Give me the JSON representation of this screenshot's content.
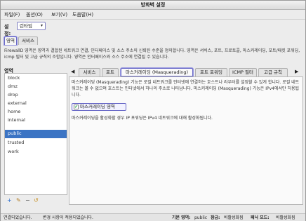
{
  "window": {
    "title": "방화벽 설정"
  },
  "menu": {
    "items": [
      {
        "label": "파일(F)"
      },
      {
        "label": "옵션(O)"
      },
      {
        "label": "보기(V)"
      },
      {
        "label": "도움말(H)"
      }
    ]
  },
  "config": {
    "label": "설정:",
    "value": "런타임"
  },
  "main_tabs": [
    {
      "label": "영역",
      "active": true
    },
    {
      "label": "서비스",
      "active": false
    }
  ],
  "description": "FirewallD 영역은 영역과 결합된 네트워크 연결, 인터페이스 및 소스 주소의 신뢰된 수준을 정의합니다. 영역은 서비스, 포트, 프로토콜, 마스커레이딩, 포트/패킷 포워딩, icmp 필터 및 고급 규칙의 조합입니다. 영역은 인터페이스와 소스 주소에 연결될 수 있습니다.",
  "zones": {
    "header": "영역",
    "items": [
      {
        "label": "block",
        "selected": false
      },
      {
        "label": "dmz",
        "selected": false
      },
      {
        "label": "drop",
        "selected": false
      },
      {
        "label": "external",
        "selected": false
      },
      {
        "label": "home",
        "selected": false
      },
      {
        "label": "internal",
        "selected": false
      },
      {
        "label": "public",
        "selected": true
      },
      {
        "label": "trusted",
        "selected": false
      },
      {
        "label": "work",
        "selected": false
      }
    ],
    "tools": [
      {
        "icon": "add-icon",
        "glyph": "+"
      },
      {
        "icon": "edit-icon",
        "glyph": "✎"
      },
      {
        "icon": "remove-icon",
        "glyph": "−"
      },
      {
        "icon": "load-defaults-icon",
        "glyph": "↺"
      }
    ]
  },
  "sub_tabs": {
    "items": [
      {
        "label": "서비스",
        "active": false
      },
      {
        "label": "포트",
        "active": false
      },
      {
        "label": "마스커레이딩 (Masquerading)",
        "active": true
      },
      {
        "label": "포트 포워딩",
        "active": false
      },
      {
        "label": "ICMP 필터",
        "active": false
      },
      {
        "label": "고급 규칙",
        "active": false
      }
    ],
    "left_arrow": "◀",
    "right_arrow": "▶"
  },
  "masquerading": {
    "description": "마스커레이딩 (Masquerading) 기능은 로컬 네트워크를 인터넷에 연결하는 호스트나 라우터를 설정할 수 있게 합니다. 로컬 네트워크는 볼 수 없으며 호스트는 인터넷에서 하나의 주소로 나타납니다. 마스커레이딩 (Masquerading) 기능은 IPv4에서만 허용됩니다.",
    "checkbox_label": "마스커레이딩 영역",
    "checked": true,
    "note": "마스커레이딩을 활성화할 경우 IP 포워딩은 IPv4 네트워크에 대해 활성화됩니다."
  },
  "status": {
    "connection": "연결되었습니다.",
    "changes": "변경 사항이 적용되었습니다.",
    "default_zone_label": "기본 영역:",
    "default_zone_value": "public",
    "lockdown_label": "잠금:",
    "lockdown_value": "비활성화됨",
    "panic_label": "패닉 모드:",
    "panic_value": "비활성화됨"
  }
}
